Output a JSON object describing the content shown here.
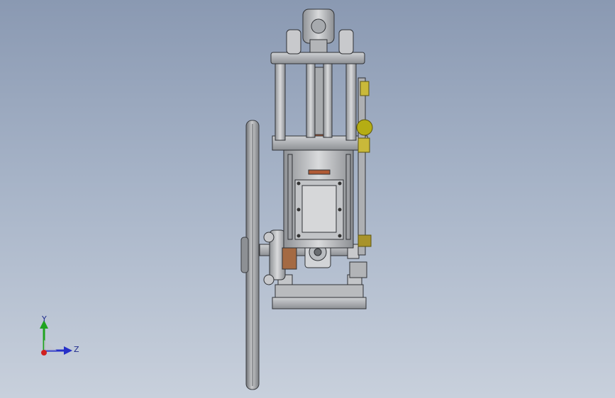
{
  "viewport": {
    "background_top": "#8a99b2",
    "background_bottom": "#c8d0dc"
  },
  "model": {
    "description_icon": "vertical-steam-engine-model"
  },
  "triad": {
    "y_label": "Y",
    "z_label": "Z",
    "colors": {
      "y": "#1fa31f",
      "z": "#2630c8",
      "x": "#d02020"
    }
  }
}
